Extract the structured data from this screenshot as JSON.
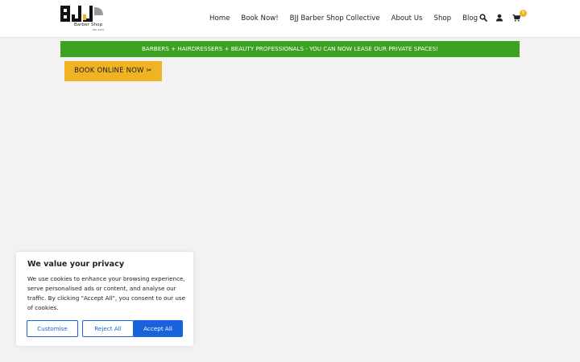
{
  "logo": {
    "text": "BJJ",
    "subtitle": "Barber Shop",
    "tagline": "Est. 2015"
  },
  "nav": {
    "items": [
      {
        "label": "Home"
      },
      {
        "label": "Book Now!"
      },
      {
        "label": "BJJ Barber Shop Collective"
      },
      {
        "label": "About Us"
      },
      {
        "label": "Shop"
      },
      {
        "label": "Blog"
      }
    ]
  },
  "header_icons": {
    "search": "search-icon",
    "account": "user-icon",
    "cart": "cart-icon",
    "cart_count": "0"
  },
  "banner": {
    "text": "BARBERS + HAIRDRESSERS + BEAUTY PROFESSIONALS - YOU CAN NOW LEASE OUR PRIVATE SPACES!"
  },
  "book_button": {
    "label": "BOOK ONLINE NOW ✂"
  },
  "cookie": {
    "title": "We value your privacy",
    "text": "We use cookies to enhance your browsing experience, serve personalised ads or content, and analyse our traffic. By clicking \"Accept All\", you consent to our use of cookies.",
    "customise": "Customise",
    "reject": "Reject All",
    "accept": "Accept All"
  },
  "colors": {
    "accent_yellow": "#f0b323",
    "banner_green": "#3aa121",
    "cookie_blue": "#1863dc"
  }
}
